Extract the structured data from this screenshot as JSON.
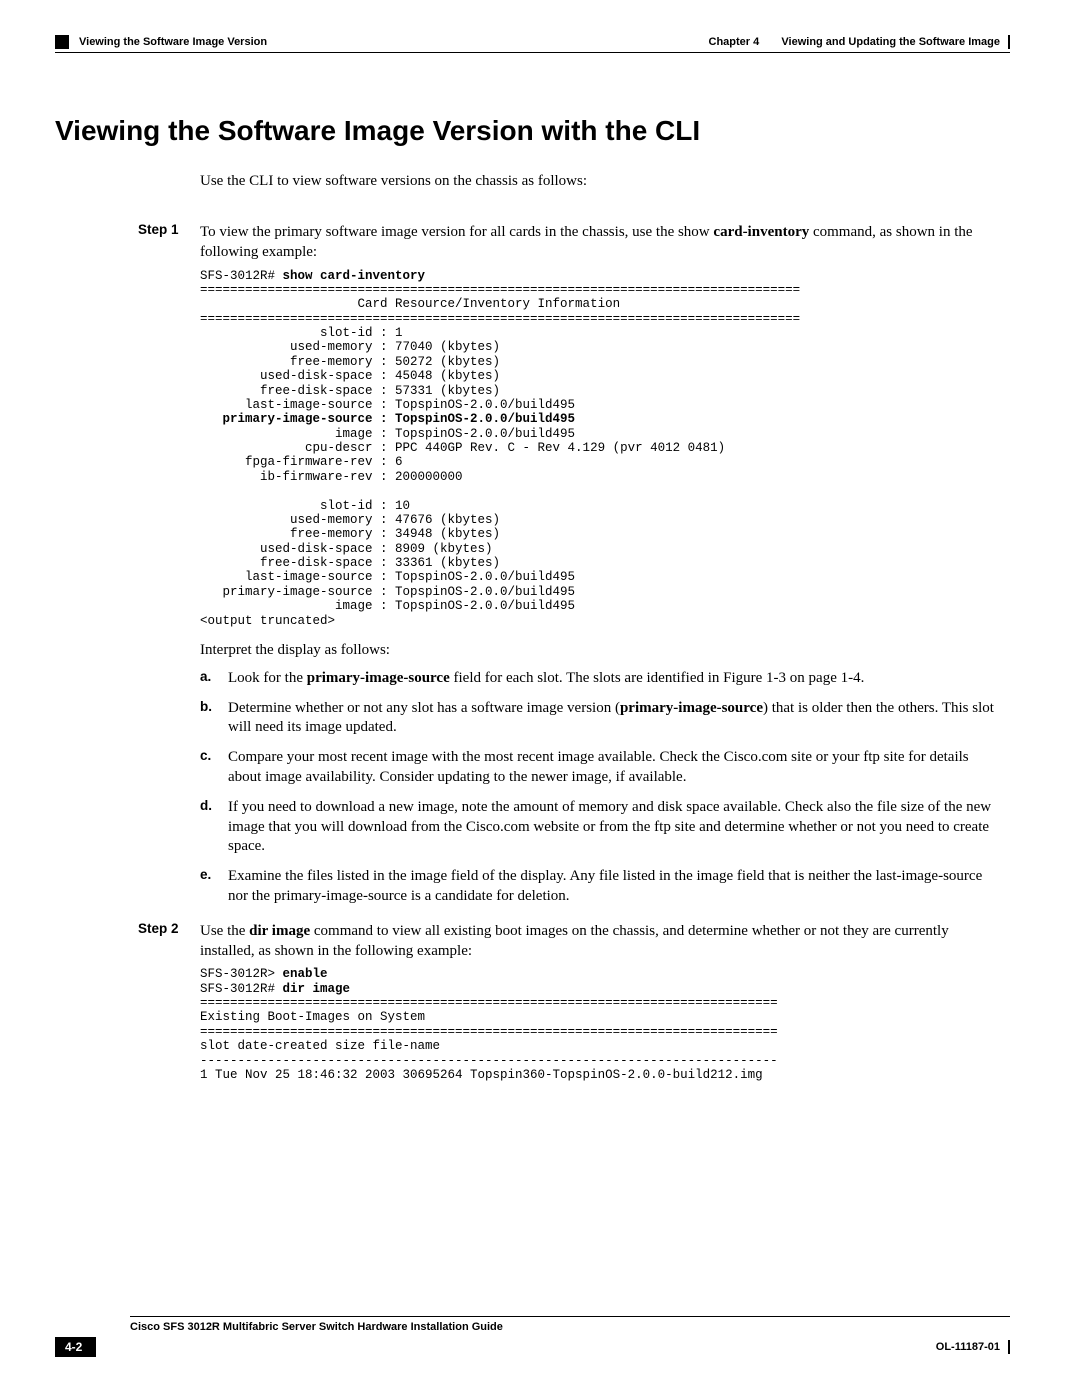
{
  "header": {
    "chapter_prefix": "Chapter 4",
    "chapter_title": "Viewing and Updating the Software Image",
    "section_header": "Viewing the Software Image Version"
  },
  "title": "Viewing the Software Image Version with the CLI",
  "intro": "Use the CLI to view software versions on the chassis as follows:",
  "step1": {
    "label": "Step 1",
    "text_a": "To view the primary software image version for all cards in the chassis, use the show ",
    "text_bold": "card-inventory",
    "text_b": " command, as shown in the following example:"
  },
  "code1": {
    "prompt": "SFS-3012R# ",
    "cmd": "show card-inventory",
    "sep": "================================================================================",
    "title": "                     Card Resource/Inventory Information",
    "lines_a": [
      "                slot-id : 1",
      "            used-memory : 77040 (kbytes)",
      "            free-memory : 50272 (kbytes)",
      "        used-disk-space : 45048 (kbytes)",
      "        free-disk-space : 57331 (kbytes)",
      "      last-image-source : TopspinOS-2.0.0/build495"
    ],
    "bold_line": "   primary-image-source : TopspinOS-2.0.0/build495",
    "lines_b": [
      "                  image : TopspinOS-2.0.0/build495",
      "              cpu-descr : PPC 440GP Rev. C - Rev 4.129 (pvr 4012 0481)",
      "      fpga-firmware-rev : 6",
      "        ib-firmware-rev : 200000000",
      "",
      "                slot-id : 10",
      "            used-memory : 47676 (kbytes)",
      "            free-memory : 34948 (kbytes)",
      "        used-disk-space : 8909 (kbytes)",
      "        free-disk-space : 33361 (kbytes)",
      "      last-image-source : TopspinOS-2.0.0/build495",
      "   primary-image-source : TopspinOS-2.0.0/build495",
      "                  image : TopspinOS-2.0.0/build495",
      "<output truncated>"
    ]
  },
  "interpret": "Interpret the display as follows:",
  "list": {
    "a": {
      "label": "a.",
      "pre": "Look for the ",
      "bold": "primary-image-source",
      "post": " field for each slot. The slots are identified in Figure 1-3 on page 1-4."
    },
    "b": {
      "label": "b.",
      "pre": "Determine whether or not any slot has a software image version (",
      "bold": "primary-image-source",
      "post": ") that is older then the others. This slot will need its image updated."
    },
    "c": {
      "label": "c.",
      "text": "Compare your most recent image with the most recent image available. Check the Cisco.com site or your ftp site for details about image availability. Consider updating to the newer image, if available."
    },
    "d": {
      "label": "d.",
      "text": "If you need to download a new image, note the amount of memory and disk space available. Check also the file size of the new image that you will download from the Cisco.com website or from the ftp site and determine whether or not you need to create space."
    },
    "e": {
      "label": "e.",
      "text": "Examine the files listed in the image field of the display. Any file listed in the image field that is neither the last-image-source nor the primary-image-source is a candidate for deletion."
    }
  },
  "step2": {
    "label": "Step 2",
    "pre": "Use the ",
    "bold": "dir image",
    "post": " command to view all existing boot images on the chassis, and determine whether or not they are currently installed, as shown in the following example:"
  },
  "code2": {
    "prompt1": "SFS-3012R> ",
    "cmd1": "enable",
    "prompt2": "SFS-3012R# ",
    "cmd2": "dir image",
    "sep": "=============================================================================",
    "title": "Existing Boot-Images on System",
    "cols": "slot date-created size file-name",
    "dash": "-----------------------------------------------------------------------------",
    "row": "1 Tue Nov 25 18:46:32 2003 30695264 Topspin360-TopspinOS-2.0.0-build212.img"
  },
  "footer": {
    "book": "Cisco SFS 3012R Multifabric Server Switch Hardware Installation Guide",
    "page": "4-2",
    "docnum": "OL-11187-01"
  }
}
